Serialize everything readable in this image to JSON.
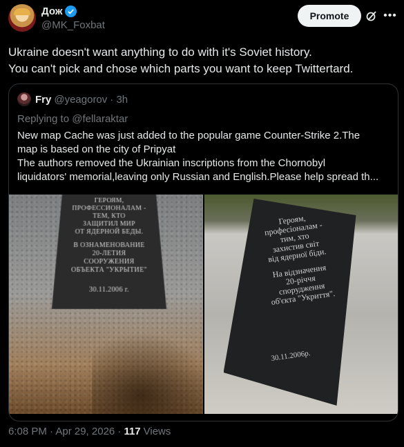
{
  "author": {
    "display_name": "Дож",
    "handle": "@MK_Foxbat",
    "verified": true
  },
  "actions": {
    "promote_label": "Promote",
    "grok_icon": "grok-icon",
    "more_icon": "more-icon"
  },
  "tweet": {
    "lines": [
      "Ukraine doesn't want anything to do with it's Soviet history.",
      "You can't pick and chose which parts you want to keep Twittertard."
    ]
  },
  "quote": {
    "display_name": "Fry",
    "handle": "@yeagorov",
    "time": "· 3h",
    "replying_to": "Replying to @fellaraktar",
    "lines": [
      "New map Cache was just added to the popular game Counter-Strike 2.The",
      "map is based on the city of Pripyat",
      "The authors removed the Ukrainian inscriptions from the Chornobyl",
      "liquidators' memorial,leaving only Russian and English.Please help spread th..."
    ],
    "image_left": {
      "plaque_lines": [
        "ГЕРОЯМ,",
        "ПРОФЕССИОНАЛАМ -",
        "ТЕМ, КТО",
        "ЗАЩИТИЛ МИР",
        "ОТ ЯДЕРНОЙ БЕДЫ.",
        "",
        "В ОЗНАМЕНОВАНИЕ",
        "20-ЛЕТИЯ",
        "СООРУЖЕНИЯ",
        "ОБЪЕКТА \"УКРЫТИЕ\"",
        "",
        "30.11.2006 г."
      ]
    },
    "image_right": {
      "plaque_lines": [
        "Героям,",
        "професіоналам -",
        "тим, хто",
        "захистив світ",
        "від ядерної біди.",
        "",
        "На відзначення",
        "20-річчя",
        "спорудження",
        "об'єкта \"Укриття\"."
      ],
      "date": "30.11.2006р."
    }
  },
  "footer": {
    "timestamp": "6:08 PM · Apr 29, 2026 ·",
    "views_count": "117",
    "views_label": "Views"
  },
  "colors": {
    "background": "#000000",
    "text": "#e7e9ea",
    "secondary": "#71767b",
    "verified": "#1d9bf0",
    "border": "#2f3336"
  }
}
